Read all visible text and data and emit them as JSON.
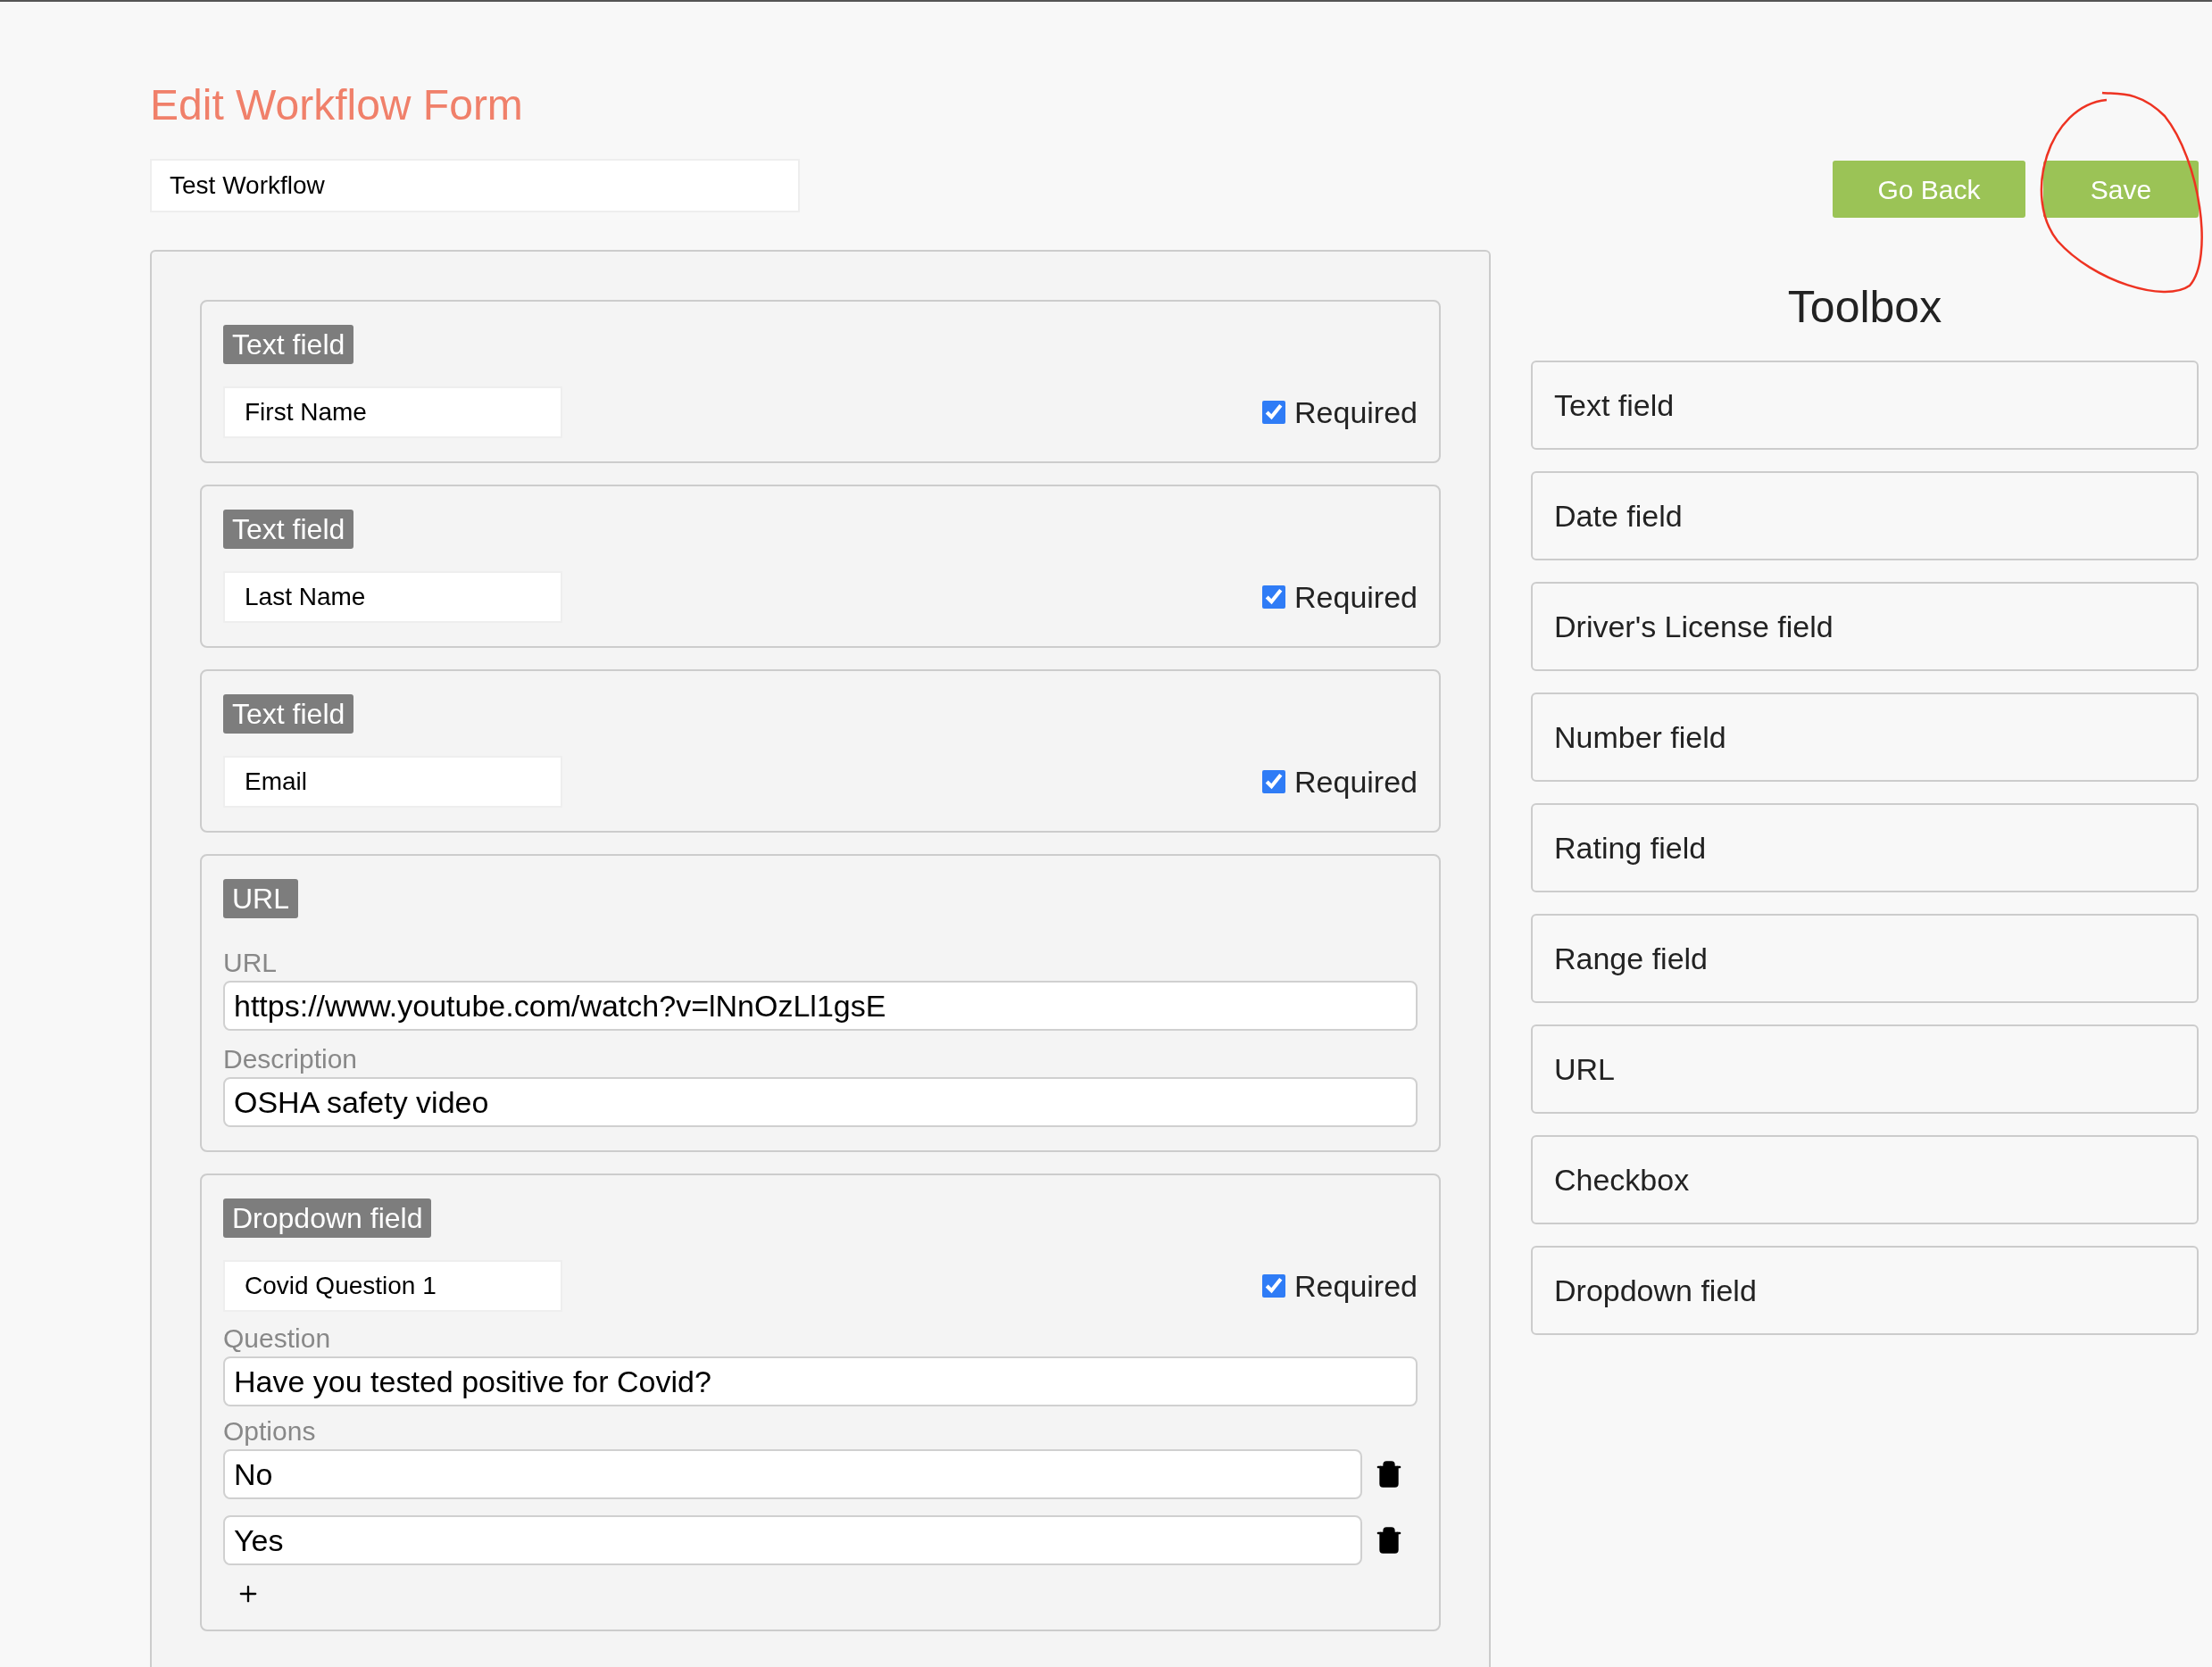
{
  "title": "Edit Workflow Form",
  "workflow_name": "Test Workflow",
  "buttons": [
    {
      "label": "Go Back"
    },
    {
      "label": "Save",
      "annotated": true
    }
  ],
  "fields": [
    {
      "kind": "text",
      "badge": "Text field",
      "name": "First Name",
      "required": true,
      "required_label": "Required"
    },
    {
      "kind": "text",
      "badge": "Text field",
      "name": "Last Name",
      "required": true,
      "required_label": "Required"
    },
    {
      "kind": "text",
      "badge": "Text field",
      "name": "Email",
      "required": true,
      "required_label": "Required"
    },
    {
      "kind": "url",
      "badge": "URL",
      "url_label": "URL",
      "url": "https://www.youtube.com/watch?v=lNnOzLl1gsE",
      "description_label": "Description",
      "description": "OSHA safety video"
    },
    {
      "kind": "dropdown",
      "badge": "Dropdown field",
      "name": "Covid Question 1",
      "required": true,
      "required_label": "Required",
      "question_label": "Question",
      "question": "Have you tested positive for Covid?",
      "options_label": "Options",
      "options": [
        "No",
        "Yes"
      ]
    }
  ],
  "toolbox": {
    "title": "Toolbox",
    "items": [
      "Text field",
      "Date field",
      "Driver's License field",
      "Number field",
      "Rating field",
      "Range field",
      "URL",
      "Checkbox",
      "Dropdown field"
    ]
  }
}
